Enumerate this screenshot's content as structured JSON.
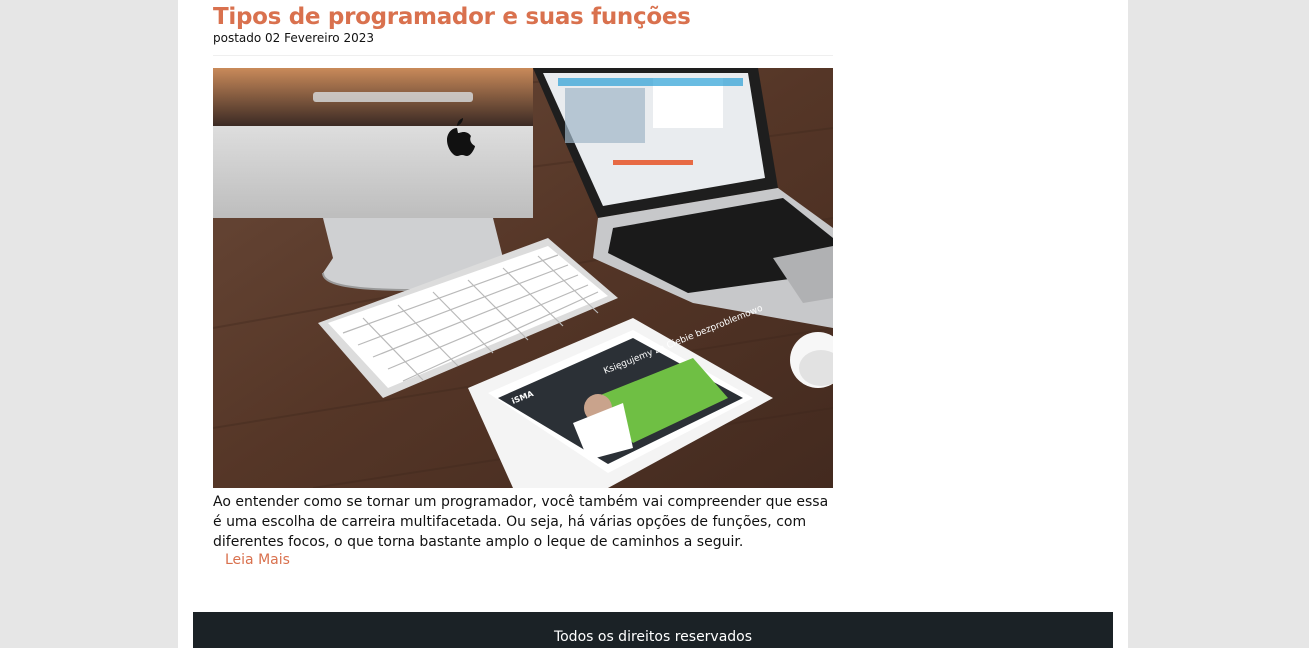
{
  "post": {
    "title": "Tipos de programador e suas funções",
    "date": "postado 02 Fevereiro 2023",
    "excerpt": "Ao entender como se tornar um programador, você também vai compreender que essa é uma escolha de carreira multifacetada. Ou seja, há várias opções de funções, com diferentes focos, o que torna bastante amplo o leque de caminhos a seguir.",
    "read_more": "Leia Mais",
    "image": {
      "tablet_headline": "Księgujemy za Ciebie bezproblemowo",
      "tablet_logo": "iSMA"
    }
  },
  "footer": {
    "copyright": "Todos os direitos reservados"
  },
  "colors": {
    "accent": "#d9714e",
    "footer_bg": "#1b2226",
    "page_bg": "#e6e6e6"
  }
}
